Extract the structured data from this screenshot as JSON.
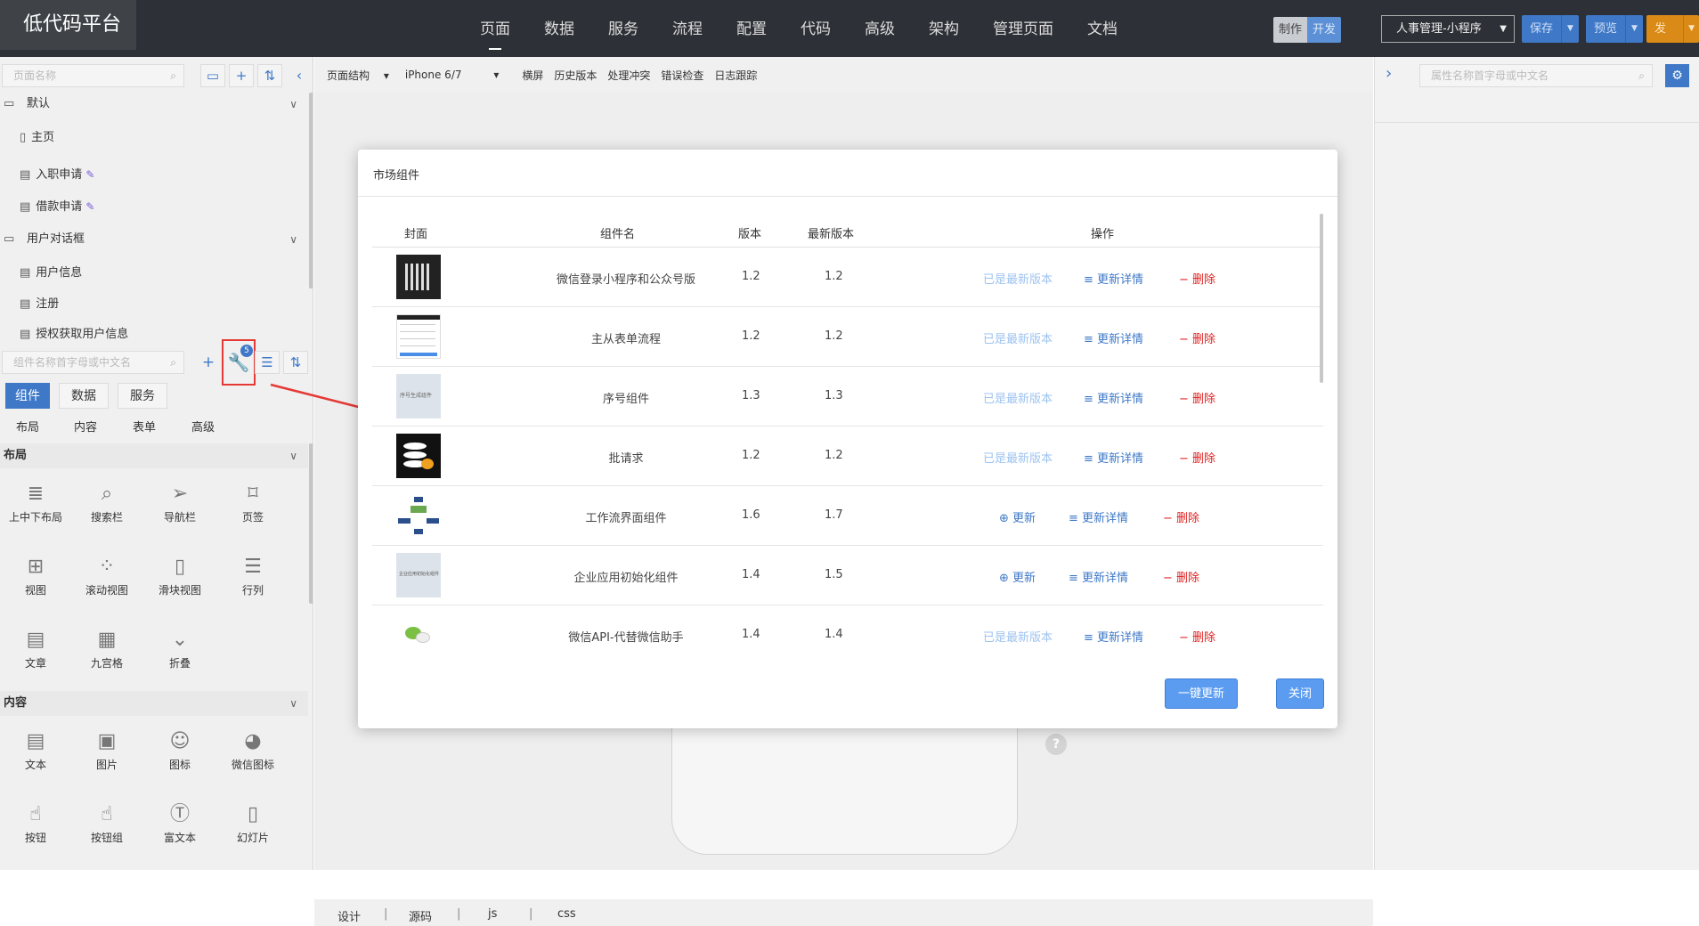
{
  "header": {
    "logo": "低代码平台",
    "nav": [
      "页面",
      "数据",
      "服务",
      "流程",
      "配置",
      "代码",
      "高级",
      "架构",
      "管理页面",
      "文档"
    ],
    "mode": [
      "制作",
      "开发"
    ],
    "app_select": "人事管理-小程序",
    "save": "保存",
    "preview": "预览",
    "publish": "发布"
  },
  "left": {
    "page_search_placeholder": "页面名称",
    "groups": [
      {
        "name": "默认",
        "pages": [
          "主页",
          "入职申请",
          "借款申请"
        ]
      },
      {
        "name": "用户对话框",
        "pages": [
          "用户信息",
          "注册",
          "授权获取用户信息"
        ]
      }
    ],
    "comp_search_placeholder": "组件名称首字母或中文名",
    "market_badge": "5",
    "tabs": [
      "组件",
      "数据",
      "服务"
    ],
    "subtabs": [
      "布局",
      "内容",
      "表单",
      "高级"
    ],
    "sections": [
      {
        "title": "布局",
        "items": [
          "上中下布局",
          "搜索栏",
          "导航栏",
          "页签",
          "视图",
          "滚动视图",
          "滑块视图",
          "行列",
          "文章",
          "九宫格",
          "折叠"
        ]
      },
      {
        "title": "内容",
        "items": [
          "文本",
          "图片",
          "图标",
          "微信图标",
          "按钮",
          "按钮组",
          "富文本",
          "幻灯片"
        ]
      }
    ]
  },
  "canvas": {
    "toolbar": [
      "页面结构",
      "iPhone 6/7",
      "横屏",
      "历史版本",
      "处理冲突",
      "错误检查",
      "日志跟踪"
    ],
    "bottom_tabs": [
      "设计",
      "源码",
      "js",
      "css"
    ],
    "help": "?"
  },
  "right": {
    "prop_search_placeholder": "属性名称首字母或中文名"
  },
  "modal": {
    "title": "市场组件",
    "headers": [
      "封面",
      "组件名",
      "版本",
      "最新版本",
      "操作"
    ],
    "rows": [
      {
        "name": "微信登录小程序和公众号版",
        "version": "1.2",
        "latest": "1.2",
        "status": "已是最新版本"
      },
      {
        "name": "主从表单流程",
        "version": "1.2",
        "latest": "1.2",
        "status": "已是最新版本"
      },
      {
        "name": "序号组件",
        "version": "1.3",
        "latest": "1.3",
        "status": "已是最新版本"
      },
      {
        "name": "批请求",
        "version": "1.2",
        "latest": "1.2",
        "status": "已是最新版本"
      },
      {
        "name": "工作流界面组件",
        "version": "1.6",
        "latest": "1.7",
        "status": "更新"
      },
      {
        "name": "企业应用初始化组件",
        "version": "1.4",
        "latest": "1.5",
        "status": "更新"
      },
      {
        "name": "微信API-代替微信助手",
        "version": "1.4",
        "latest": "1.4",
        "status": "已是最新版本"
      }
    ],
    "detail_label": "更新详情",
    "delete_label": "删除",
    "update_all": "一键更新",
    "close": "关闭",
    "cover_texts": [
      "序号生成组件",
      "企业应用初始化组件"
    ]
  }
}
